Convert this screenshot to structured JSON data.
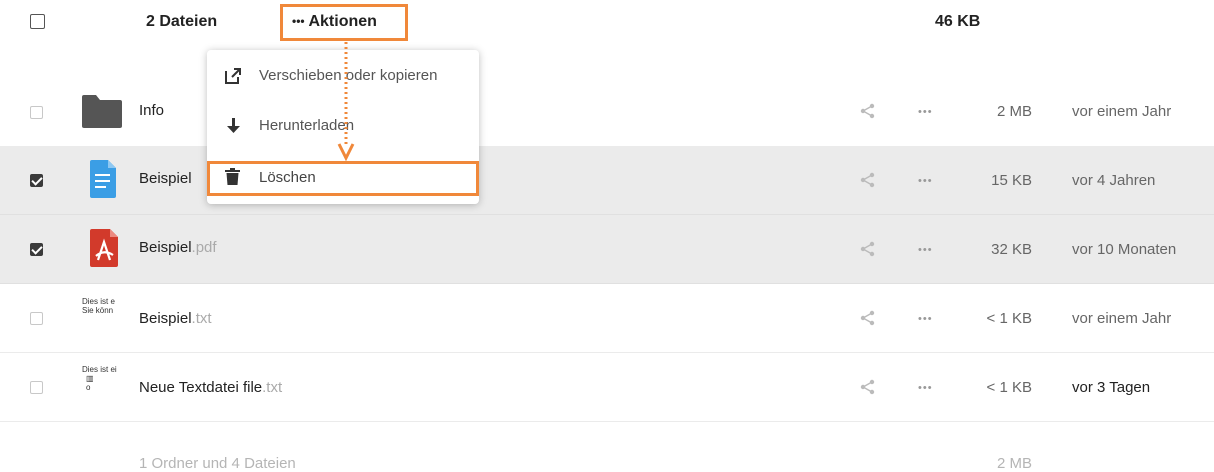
{
  "header": {
    "count_label": "2 Dateien",
    "actions_dots": "•••",
    "actions_label": "Aktionen",
    "total_size": "46 KB"
  },
  "menu": {
    "items": [
      {
        "label": "Verschieben oder kopieren",
        "icon": "external-link-icon"
      },
      {
        "label": "Herunterladen",
        "icon": "download-icon"
      },
      {
        "label": "Löschen",
        "icon": "trash-icon"
      }
    ]
  },
  "files": [
    {
      "name": "Info",
      "ext": "",
      "size": "2 MB",
      "date": "vor einem Jahr",
      "selected": false,
      "icon": "folder-icon"
    },
    {
      "name": "Beispiel",
      "ext": "",
      "size": "15 KB",
      "date": "vor 4 Jahren",
      "selected": true,
      "icon": "document-icon"
    },
    {
      "name": "Beispiel",
      "ext": ".pdf",
      "size": "32 KB",
      "date": "vor 10 Monaten",
      "selected": true,
      "icon": "pdf-icon"
    },
    {
      "name": "Beispiel",
      "ext": ".txt",
      "size": "< 1 KB",
      "date": "vor einem Jahr",
      "selected": false,
      "icon": "text-preview-icon",
      "preview": [
        "Dies ist e",
        "Sie könn"
      ]
    },
    {
      "name": "Neue Textdatei file",
      "ext": ".txt",
      "size": "< 1 KB",
      "date": "vor 3 Tagen",
      "selected": false,
      "icon": "text-preview-icon",
      "preview": [
        "Dies ist ei",
        "▥",
        "o"
      ]
    }
  ],
  "footer": {
    "summary": "1 Ordner und 4 Dateien",
    "total": "2 MB"
  },
  "colors": {
    "highlight": "#f0883a",
    "folder": "#555555",
    "doc_blue": "#3b9ee5",
    "pdf_red": "#d23a2b"
  }
}
